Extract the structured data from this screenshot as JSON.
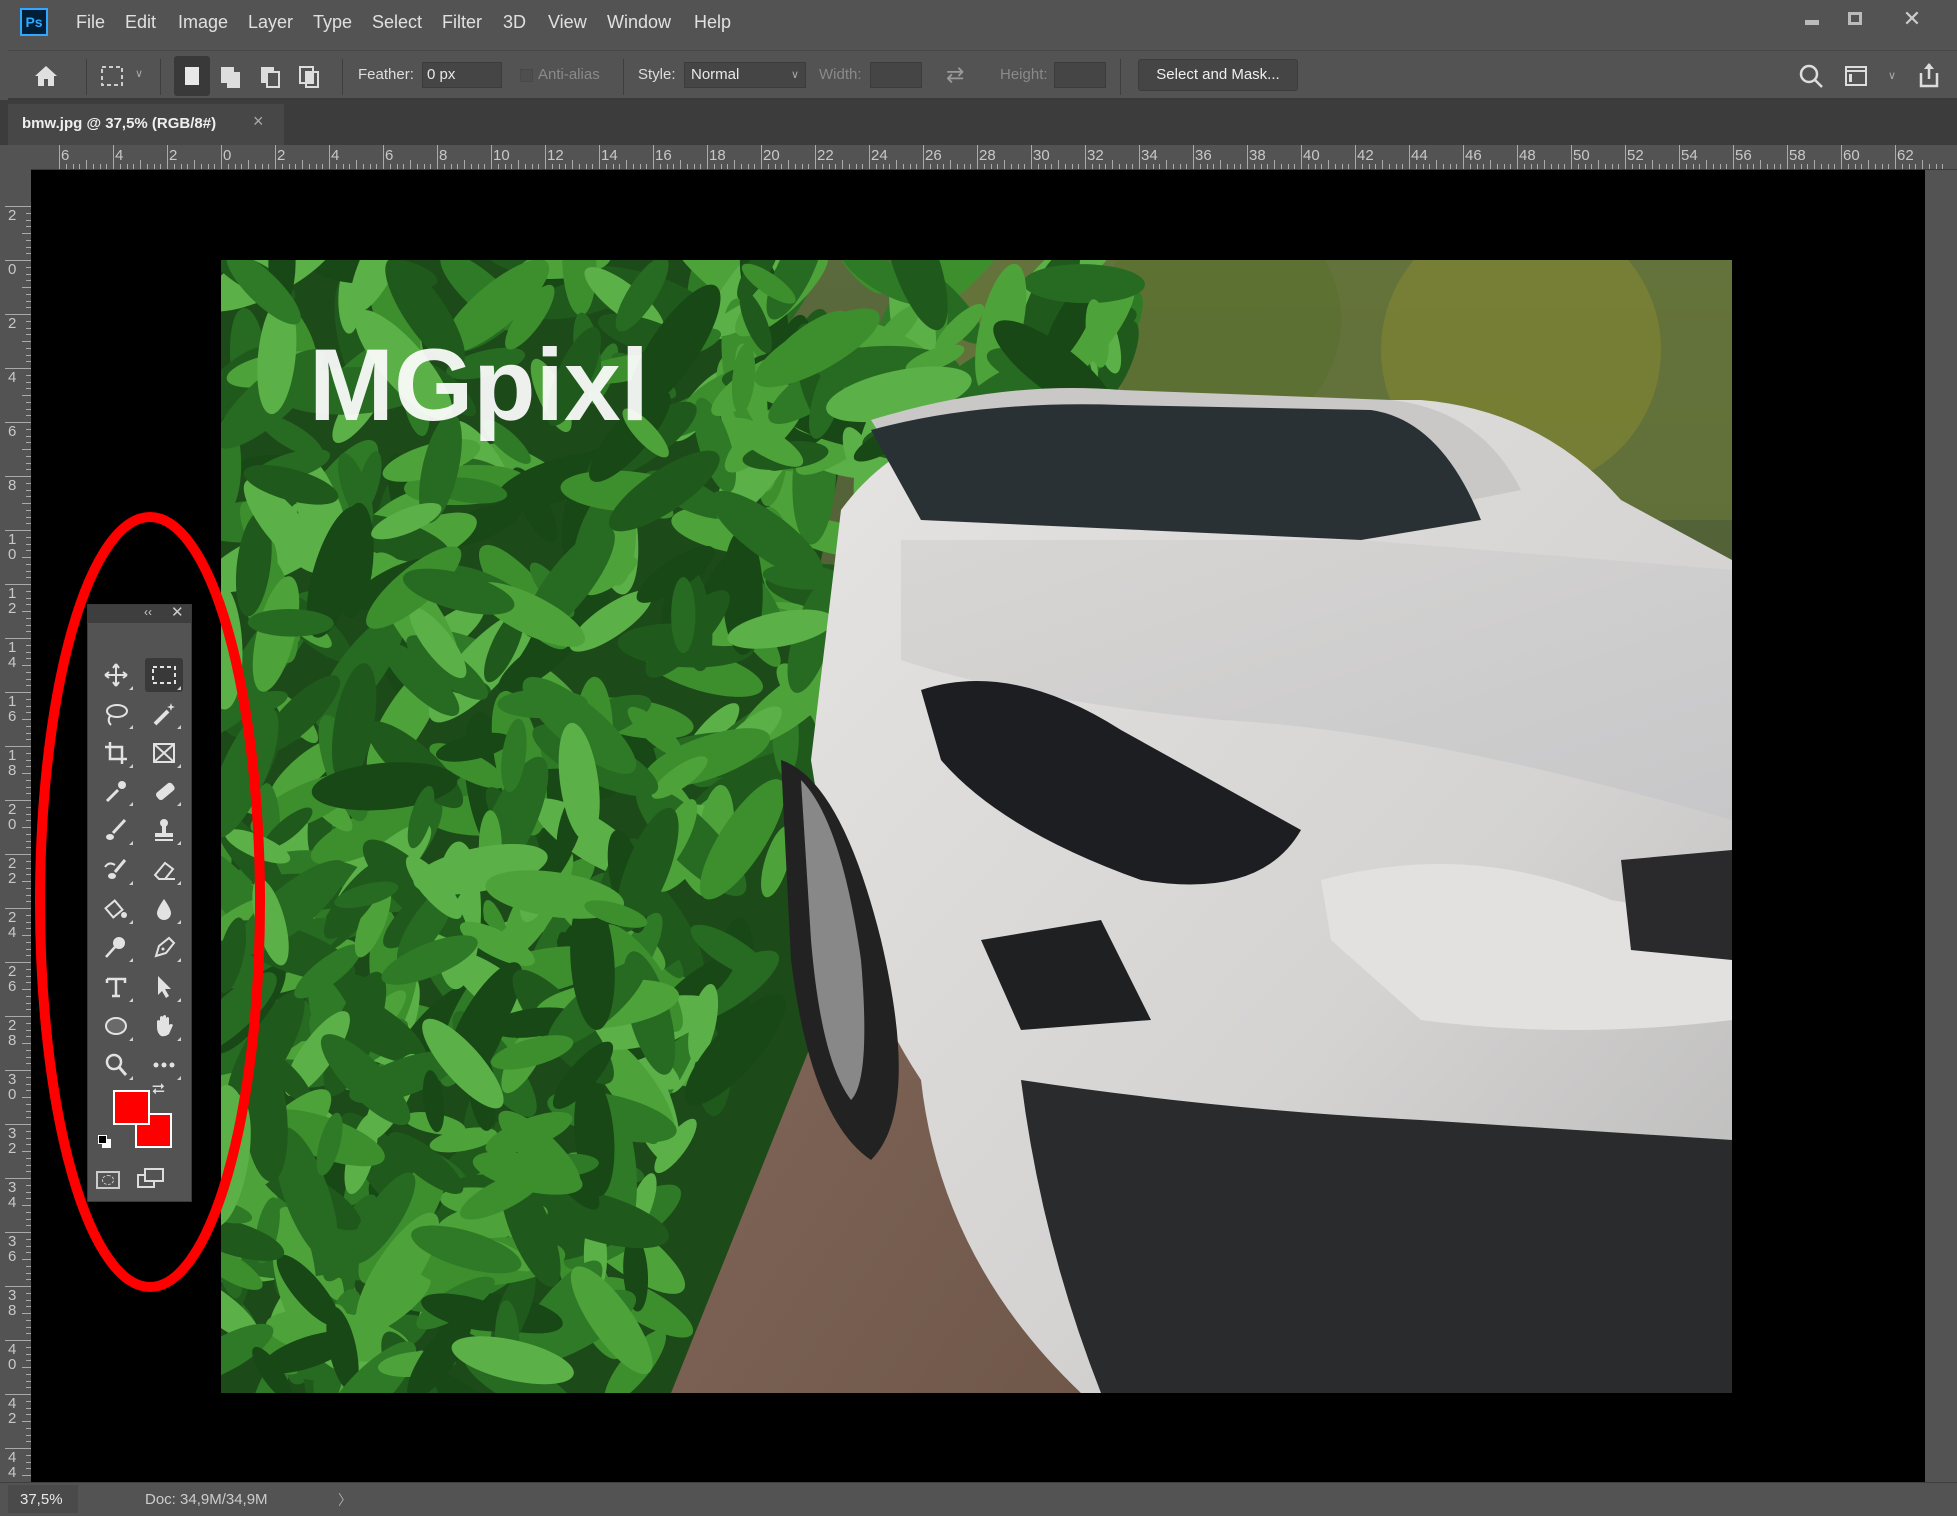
{
  "app": {
    "logo": "Ps"
  },
  "menu": [
    "File",
    "Edit",
    "Image",
    "Layer",
    "Type",
    "Select",
    "Filter",
    "3D",
    "View",
    "Window",
    "Help"
  ],
  "window_controls": {
    "minimize": "minimize-icon",
    "maximize": "maximize-icon",
    "close": "close-icon"
  },
  "options": {
    "feather_label": "Feather:",
    "feather_value": "0 px",
    "antialias_label": "Anti-alias",
    "antialias_checked": false,
    "style_label": "Style:",
    "style_value": "Normal",
    "width_label": "Width:",
    "height_label": "Height:",
    "select_mask": "Select and Mask..."
  },
  "document": {
    "tab_title": "bmw.jpg @ 37,5% (RGB/8#)",
    "tab_close": "×",
    "watermark": "MGpixl"
  },
  "rulers": {
    "horizontal": [
      "6",
      "4",
      "2",
      "0",
      "2",
      "4",
      "6",
      "8",
      "10",
      "12",
      "14",
      "16",
      "18",
      "20",
      "22",
      "24",
      "26",
      "28",
      "30",
      "32",
      "34",
      "36",
      "38",
      "40",
      "42",
      "44",
      "46",
      "48",
      "50",
      "52",
      "54",
      "56",
      "58",
      "60",
      "62"
    ],
    "vertical": [
      "2",
      "0",
      "2",
      "4",
      "6",
      "8",
      "10",
      "12",
      "14",
      "16",
      "18",
      "20",
      "22",
      "24",
      "26",
      "28",
      "30",
      "32",
      "34",
      "36",
      "38",
      "40",
      "42",
      "44"
    ]
  },
  "toolbox": {
    "tools": [
      [
        "move",
        "rectangular-marquee"
      ],
      [
        "lasso",
        "magic-wand"
      ],
      [
        "crop",
        "frame"
      ],
      [
        "eyedropper",
        "healing-brush"
      ],
      [
        "brush",
        "clone-stamp"
      ],
      [
        "history-brush",
        "eraser"
      ],
      [
        "paint-bucket",
        "blur"
      ],
      [
        "dodge",
        "pen"
      ],
      [
        "type",
        "path-selection"
      ],
      [
        "ellipse",
        "hand"
      ],
      [
        "zoom",
        "more-tools"
      ]
    ],
    "active": "rectangular-marquee",
    "foreground_color": "#ff0000",
    "background_color": "#ff0000"
  },
  "status": {
    "zoom": "37,5%",
    "doc": "Doc: 34,9M/34,9M",
    "arrow": "〉"
  },
  "annotation": {
    "color": "#ff0000"
  }
}
